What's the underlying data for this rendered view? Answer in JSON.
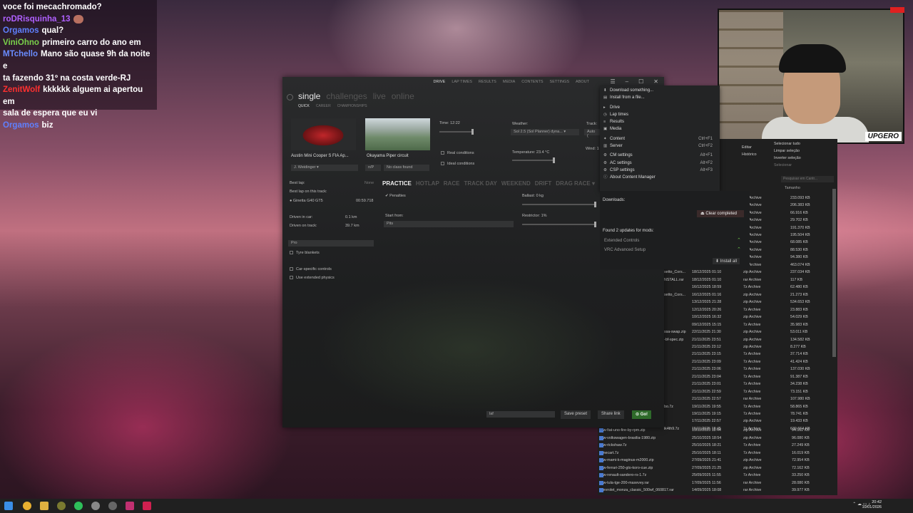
{
  "chat": [
    {
      "user": "",
      "user_color": "#ffffff",
      "text": "voce foi mecachromado?"
    },
    {
      "user": "roDRisquinha_13",
      "user_color": "#b060ff",
      "text": ""
    },
    {
      "user": "Orgamos",
      "user_color": "#6080ff",
      "text": "qual?"
    },
    {
      "user": "ViniOhno",
      "user_color": "#7ad04a",
      "text": "primeiro carro do ano em"
    },
    {
      "user": "MTchello",
      "user_color": "#6a8cff",
      "text": "Mano são quase 9h da noite e"
    },
    {
      "user": "",
      "user_color": "#ffffff",
      "text": "ta fazendo 31º na costa verde-RJ"
    },
    {
      "user": "ZenitWolf",
      "user_color": "#ff3030",
      "text": "kkkkkk alguem ai apertou em"
    },
    {
      "user": "",
      "user_color": "#ffffff",
      "text": "sala de espera que eu vi"
    },
    {
      "user": "Orgamos",
      "user_color": "#6080ff",
      "text": "biz"
    }
  ],
  "webcam": {
    "logo": "UPGERO"
  },
  "cm": {
    "nav": [
      "DRIVE",
      "LAP TIMES",
      "RESULTS",
      "MEDIA",
      "CONTENTS",
      "SETTINGS",
      "ABOUT"
    ],
    "tabs": [
      "single",
      "challenges",
      "live",
      "online"
    ],
    "subtabs": [
      "QUICK",
      "CAREER",
      "CHAMPIONSHIPS"
    ],
    "car_name": "Austin Mini Cooper S FIA Ap...",
    "track_name": "Okayama Piper circuit",
    "driver": "J. Weidinger",
    "skin": "n/P",
    "track_layout": "No class found",
    "time_label": "Time: 12:22",
    "weather_label": "Weather:",
    "weather_value": "Sol 2.5 (Sol Planner) dyna...",
    "track_label": "Track:",
    "track_state": "Auto (",
    "temperature_label": "Temperature: 23.4 °C",
    "wind_label": "Wind: 1",
    "real_conditions": "Real conditions",
    "ideal_conditions": "Ideal conditions",
    "best_lap_label": "Best lap:",
    "best_lap_value": "None",
    "best_lap_track_label": "Best lap on this track:",
    "best_lap_track_car": "Ginetta G40 GT5",
    "best_lap_track_time": "00:59.718",
    "modes": [
      "PRACTICE",
      "HOTLAP",
      "RACE",
      "TRACK DAY",
      "WEEKEND",
      "DRIFT",
      "DRAG RACE ▾"
    ],
    "penalties": "Penalties",
    "ballast": "Ballast: 0 kg",
    "restrictor": "Restrictor: 1%",
    "start_from_label": "Start from:",
    "start_from_value": "Pits",
    "driven_car_label": "Driven in car:",
    "driven_car_value": "0.1 km",
    "driven_track_label": "Driven on track:",
    "driven_track_value": "39.7 km",
    "assist_preset": "Pro",
    "tyre_blankets": "Tyre blankets",
    "car_specific": "Car-specific controls",
    "extended_physics": "Use extended physics",
    "preset_value": "laf",
    "save_preset": "Save preset",
    "share_link": "Share link",
    "go": "⊙ Go!"
  },
  "menu": [
    {
      "label": "Download something...",
      "shortcut": "",
      "icon": "download-icon"
    },
    {
      "label": "Install from a file...",
      "shortcut": "",
      "icon": "file-icon"
    },
    {
      "sep": true
    },
    {
      "label": "Drive",
      "shortcut": "",
      "icon": "drive-icon"
    },
    {
      "label": "Lap times",
      "shortcut": "",
      "icon": "clock-icon"
    },
    {
      "label": "Results",
      "shortcut": "",
      "icon": "results-icon"
    },
    {
      "label": "Media",
      "shortcut": "",
      "icon": "media-icon"
    },
    {
      "sep": true
    },
    {
      "label": "Content",
      "shortcut": "Ctrl+F1",
      "icon": "content-icon"
    },
    {
      "label": "Server",
      "shortcut": "Ctrl+F2",
      "icon": "server-icon"
    },
    {
      "sep": true
    },
    {
      "label": "CM settings",
      "shortcut": "Alt+F1",
      "icon": "gear-icon"
    },
    {
      "label": "AC settings",
      "shortcut": "Alt+F2",
      "icon": "gear-icon"
    },
    {
      "label": "CSP settings",
      "shortcut": "Alt+F3",
      "icon": "gear-icon"
    },
    {
      "label": "About Content Manager",
      "shortcut": "",
      "icon": "info-icon"
    }
  ],
  "downloads": {
    "title": "Downloads:",
    "clear": "⏏ Clear completed",
    "updates_title": "Found 2 updates for mods:",
    "updates": [
      "Extended Controls",
      "VRC Advanced Setup"
    ],
    "install_all": "⬇ Install all"
  },
  "explorer": {
    "select": [
      "Selecionar tudo",
      "Limpar seleção",
      "Inverter seleção"
    ],
    "left_actions": [
      "Editar",
      "Histórico"
    ],
    "section": "Selecionar",
    "search_placeholder": "Pesquisar em Cantr...",
    "col_size": "Tamanho",
    "top_rows": [
      {
        "type": "Archive",
        "size": "233.093 KB"
      },
      {
        "type": "Archive",
        "size": "206.383 KB"
      },
      {
        "type": "Archive",
        "size": "66.916 KB"
      },
      {
        "type": "Archive",
        "size": "29.702 KB"
      },
      {
        "type": "Archive",
        "size": "191.370 KB"
      },
      {
        "type": "Archive",
        "size": "195.504 KB"
      },
      {
        "type": "Archive",
        "size": "68.085 KB"
      },
      {
        "type": "Archive",
        "size": "88.530 KB"
      },
      {
        "type": "Archive",
        "size": "94.380 KB"
      }
    ],
    "rows": [
      {
        "name": "",
        "date": "18/12/2025 01:11",
        "type": "rar Archive",
        "size": "463.074 KB"
      },
      {
        "name": "setto_Cors...",
        "date": "18/12/2025 01:10",
        "type": "zip Archive",
        "size": "237.034 KB"
      },
      {
        "name": "NSTALL.rar",
        "date": "18/12/2025 01:10",
        "type": "rar Archive",
        "size": "117 KB"
      },
      {
        "name": "",
        "date": "16/12/2025 18:59",
        "type": "7z Archive",
        "size": "62.480 KB"
      },
      {
        "name": "setto_Cors...",
        "date": "16/12/2025 01:16",
        "type": "zip Archive",
        "size": "21.273 KB"
      },
      {
        "name": "",
        "date": "13/12/2025 21:28",
        "type": "zip Archive",
        "size": "534.653 KB"
      },
      {
        "name": "",
        "date": "12/12/2025 20:26",
        "type": "7z Archive",
        "size": "23.883 KB"
      },
      {
        "name": "",
        "date": "10/12/2025 16:32",
        "type": "zip Archive",
        "size": "54.029 KB"
      },
      {
        "name": "",
        "date": "09/12/2025 15:15",
        "type": "7z Archive",
        "size": "35.983 KB"
      },
      {
        "name": "ssa-swap.zip",
        "date": "22/11/2025 21:30",
        "type": "zip Archive",
        "size": "53.011 KB"
      },
      {
        "name": "-bf-spec.zip",
        "date": "21/11/2025 23:51",
        "type": "zip Archive",
        "size": "134.582 KB"
      },
      {
        "name": "",
        "date": "21/11/2025 23:12",
        "type": "zip Archive",
        "size": "8.277 KB"
      },
      {
        "name": "",
        "date": "21/11/2025 23:15",
        "type": "7z Archive",
        "size": "37.714 KB"
      },
      {
        "name": "",
        "date": "21/11/2025 23:09",
        "type": "7z Archive",
        "size": "41.424 KB"
      },
      {
        "name": "",
        "date": "21/11/2025 23:06",
        "type": "7z Archive",
        "size": "137.030 KB"
      },
      {
        "name": "",
        "date": "21/11/2025 23:04",
        "type": "7z Archive",
        "size": "91.387 KB"
      },
      {
        "name": "",
        "date": "21/11/2025 23:01",
        "type": "7z Archive",
        "size": "34.238 KB"
      },
      {
        "name": "",
        "date": "21/11/2025 22:59",
        "type": "7z Archive",
        "size": "73.151 KB"
      },
      {
        "name": "",
        "date": "21/11/2025 22:57",
        "type": "rar Archive",
        "size": "107.980 KB"
      },
      {
        "name": "bo.7z",
        "date": "19/11/2025 19:55",
        "type": "7z Archive",
        "size": "58.865 KB"
      },
      {
        "name": "",
        "date": "19/11/2025 19:15",
        "type": "7z Archive",
        "size": "78.741 KB"
      },
      {
        "name": "",
        "date": "17/11/2025 22:57",
        "type": "zip Archive",
        "size": "19.433 KB"
      },
      {
        "name": "ik4th9.7z",
        "date": "15/11/2025 18:45",
        "type": "7z Archive",
        "size": "630.664 KB"
      }
    ],
    "bottom_rows": [
      {
        "name": "asw-fiat-uno-fire-by-rpm.zip",
        "date": "15/11/2025 18:44",
        "type": "zip Archive",
        "size": "94.162 KB"
      },
      {
        "name": "asw-volkswagen-brasilia-1980.zip",
        "date": "25/10/2025 18:54",
        "type": "zip Archive",
        "size": "96.080 KB"
      },
      {
        "name": "asw-rickshaw.7z",
        "date": "25/10/2025 18:21",
        "type": "7z Archive",
        "size": "27.249 KB"
      },
      {
        "name": "minecart.7z",
        "date": "25/10/2025 18:11",
        "type": "7z Archive",
        "size": "16.019 KB"
      },
      {
        "name": "asw-mami-k-maginus-m2000.zip",
        "date": "27/09/2025 21:41",
        "type": "zip Archive",
        "size": "72.954 KB"
      },
      {
        "name": "asw-ferrari-250-gto-koro-cue.zip",
        "date": "27/09/2025 21:25",
        "type": "zip Archive",
        "size": "72.162 KB"
      },
      {
        "name": "asw-renault-sandero-rs-1.7z",
        "date": "25/09/2025 11:55",
        "type": "7z Archive",
        "size": "33.250 KB"
      },
      {
        "name": "asw-tula-tge-200-maxevey.rar",
        "date": "17/09/2025 11:56",
        "type": "rar Archive",
        "size": "28.080 KB"
      },
      {
        "name": "chevrolet_monza_classic_500wf_060817.rar",
        "date": "14/09/2025 18:08",
        "type": "rar Archive",
        "size": "39.977 KB"
      }
    ]
  },
  "taskbar": {
    "time": "20:42",
    "date": "10/01/2026"
  }
}
